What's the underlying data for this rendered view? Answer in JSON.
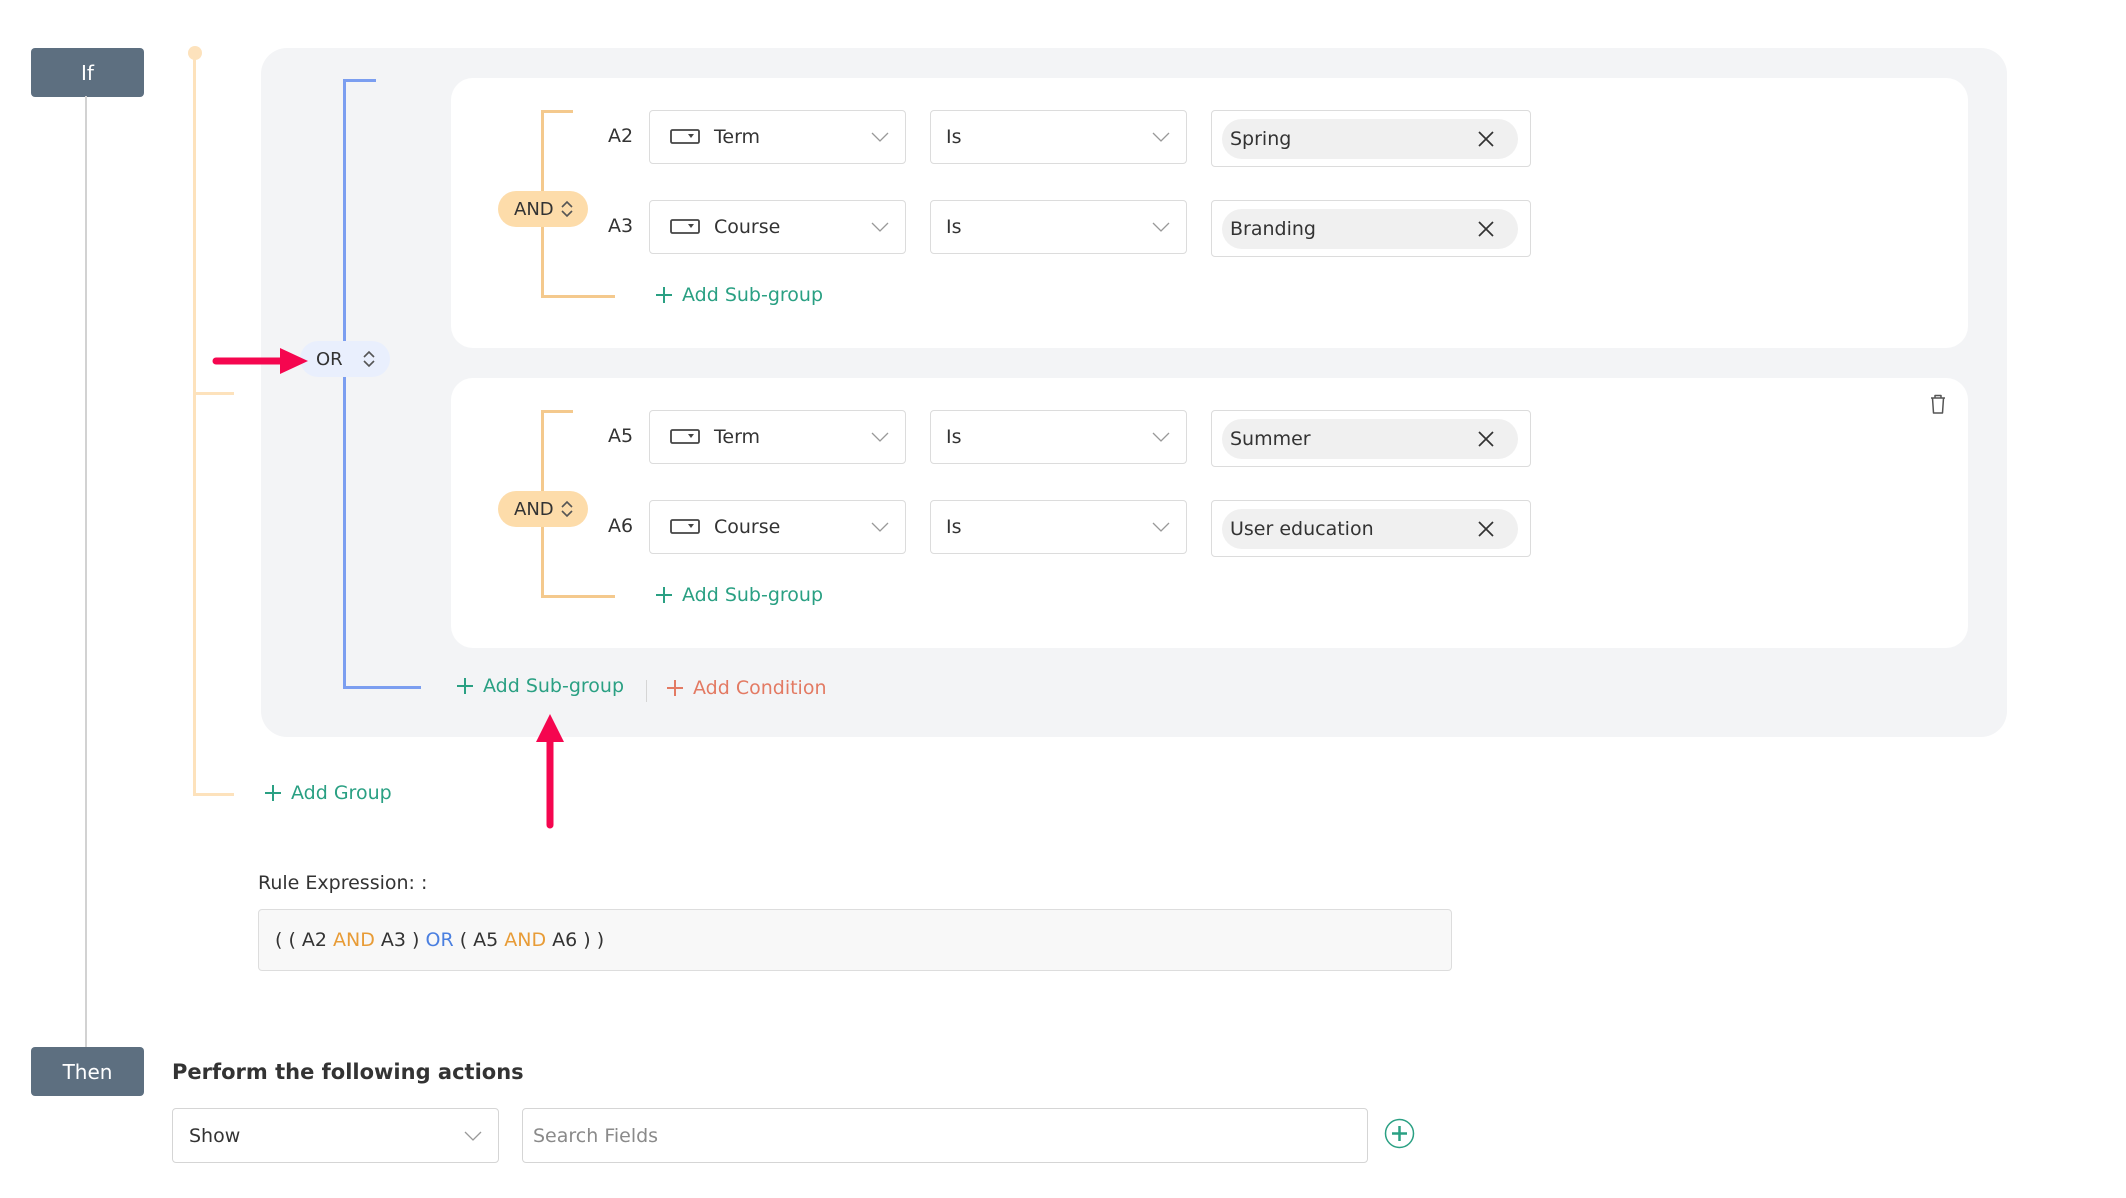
{
  "if_label": "If",
  "then_label": "Then",
  "root_operator": "OR",
  "groups": [
    {
      "operator": "AND",
      "conditions": [
        {
          "id": "A2",
          "field": "Term",
          "operator": "Is",
          "value": "Spring"
        },
        {
          "id": "A3",
          "field": "Course",
          "operator": "Is",
          "value": "Branding"
        }
      ],
      "add_subgroup_label": "Add Sub-group"
    },
    {
      "operator": "AND",
      "conditions": [
        {
          "id": "A5",
          "field": "Term",
          "operator": "Is",
          "value": "Summer"
        },
        {
          "id": "A6",
          "field": "Course",
          "operator": "Is",
          "value": "User education"
        }
      ],
      "add_subgroup_label": "Add Sub-group",
      "delete_icon": "trash-icon"
    }
  ],
  "group_actions": {
    "add_subgroup_label": "Add Sub-group",
    "add_condition_label": "Add Condition"
  },
  "add_group_label": "Add Group",
  "rule_expression": {
    "label": "Rule Expression: :",
    "tokens": [
      {
        "t": "( ( A2 ",
        "k": "plain"
      },
      {
        "t": "AND",
        "k": "and"
      },
      {
        "t": " A3 ) ",
        "k": "plain"
      },
      {
        "t": "OR",
        "k": "or"
      },
      {
        "t": " ( A5 ",
        "k": "plain"
      },
      {
        "t": "AND",
        "k": "and"
      },
      {
        "t": " A6 ) )",
        "k": "plain"
      }
    ]
  },
  "actions": {
    "title": "Perform the following actions",
    "action_select": "Show",
    "search_placeholder": "Search Fields",
    "search_value": ""
  },
  "colors": {
    "step_box": "#5d6f80",
    "and_pill": "#fddcaa",
    "or_pill": "#e9effd",
    "add_link": "#2aa083",
    "add_condition": "#e37a63",
    "annotation_arrow": "#f5064f"
  },
  "annotations": [
    "arrow pointing at OR operator",
    "arrow pointing at Add Sub-group"
  ]
}
